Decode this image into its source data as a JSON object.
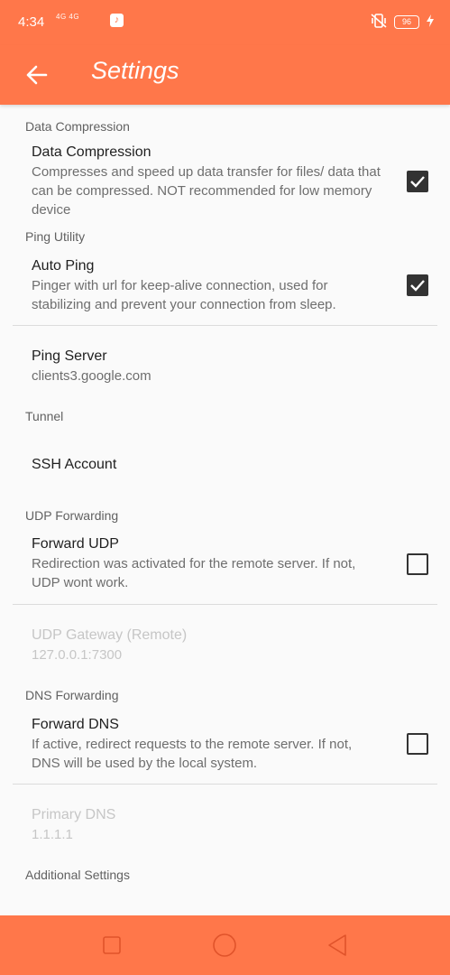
{
  "status_bar": {
    "time": "4:34",
    "network_text": "4G 4G",
    "battery_text": "96"
  },
  "app_bar": {
    "title": "Settings"
  },
  "sections": {
    "data_compression": {
      "category": "Data Compression",
      "title": "Data Compression",
      "summary": "Compresses and speed up data transfer for files/ data that can be compressed. NOT recommended for low memory device",
      "checked": true
    },
    "ping_utility": {
      "category": "Ping Utility",
      "auto_ping_title": "Auto Ping",
      "auto_ping_summary": "Pinger with url for keep-alive connection, used for stabilizing and prevent your connection from sleep.",
      "auto_ping_checked": true,
      "ping_server_title": "Ping Server",
      "ping_server_value": "clients3.google.com"
    },
    "tunnel": {
      "category": "Tunnel",
      "ssh_account_title": "SSH Account"
    },
    "udp_forwarding": {
      "category": "UDP Forwarding",
      "forward_udp_title": "Forward UDP",
      "forward_udp_summary": "Redirection was activated for the remote server. If not, UDP wont work.",
      "forward_udp_checked": false,
      "udp_gateway_title": "UDP Gateway (Remote)",
      "udp_gateway_value": "127.0.0.1:7300"
    },
    "dns_forwarding": {
      "category": "DNS Forwarding",
      "forward_dns_title": "Forward DNS",
      "forward_dns_summary": "If active, redirect requests to the remote server. If not, DNS will be used by the local system.",
      "forward_dns_checked": false,
      "primary_dns_title": "Primary DNS",
      "primary_dns_value": "1.1.1.1"
    },
    "additional": {
      "category": "Additional Settings"
    }
  },
  "icons": {
    "back": "arrow-back-icon",
    "nav_recents": "square-icon",
    "nav_home": "circle-icon",
    "nav_back": "triangle-icon"
  },
  "colors": {
    "accent": "#ff774a",
    "checkbox": "#333333"
  }
}
